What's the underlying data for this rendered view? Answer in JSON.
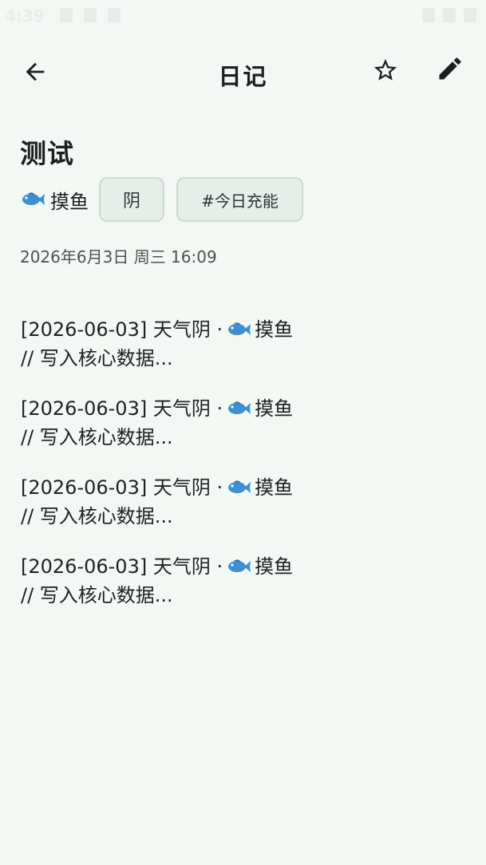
{
  "status_bar": {
    "time": "4:39"
  },
  "app_bar": {
    "title": "日记",
    "back_icon": "arrow-back-icon",
    "favorite_icon": "star-outline-icon",
    "edit_icon": "pencil-icon"
  },
  "entry": {
    "title": "测试",
    "mood": {
      "icon": "fish-emoji",
      "label": "摸鱼"
    },
    "weather_chip": "阴",
    "tag_chip": "#今日充能",
    "date": "2026年6月3日 周三 16:09",
    "blocks": [
      {
        "prefix": "[2026-06-03] 天气阴 ·",
        "mood": "摸鱼",
        "text": "// 写入核心数据..."
      },
      {
        "prefix": "[2026-06-03] 天气阴 ·",
        "mood": "摸鱼",
        "text": "// 写入核心数据..."
      },
      {
        "prefix": "[2026-06-03] 天气阴 ·",
        "mood": "摸鱼",
        "text": "// 写入核心数据..."
      },
      {
        "prefix": "[2026-06-03] 天气阴 ·",
        "mood": "摸鱼",
        "text": "// 写入核心数据..."
      }
    ]
  },
  "colors": {
    "background": "#f4f8f5",
    "chip_background": "#e5eee9",
    "chip_border": "#c9dbd3",
    "fish": "#3d8fd1"
  }
}
